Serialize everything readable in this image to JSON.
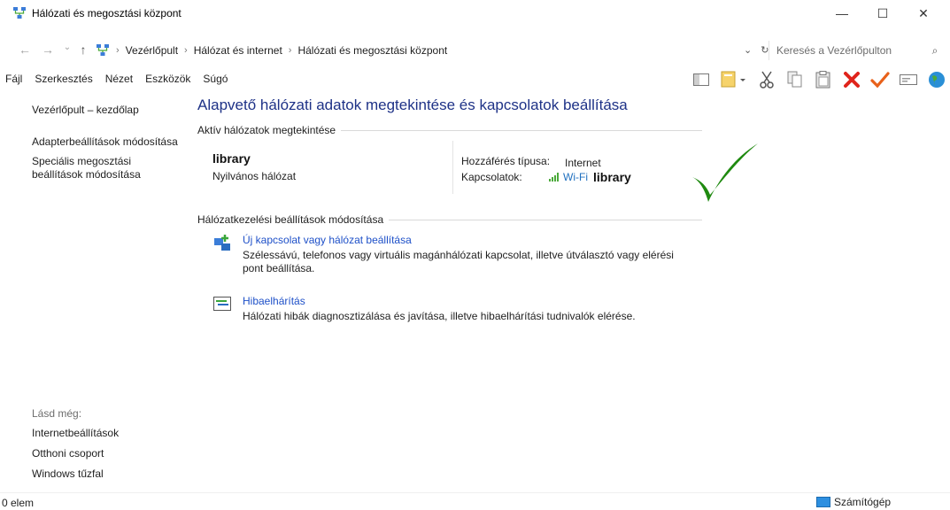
{
  "window": {
    "title": "Hálózati és megosztási központ",
    "controls": {
      "minimize": "—",
      "maximize": "☐",
      "close": "✕"
    }
  },
  "address": {
    "back": "←",
    "forward": "→",
    "history": "⌄",
    "up": "↑",
    "crumbs": [
      "Vezérlőpult",
      "Hálózat és internet",
      "Hálózati és megosztási központ"
    ],
    "separator": "›",
    "dropdown": "⌄",
    "refresh": "↻"
  },
  "search": {
    "placeholder": "Keresés a Vezérlőpulton",
    "icon": "⌕"
  },
  "menu": [
    "Fájl",
    "Szerkesztés",
    "Nézet",
    "Eszközök",
    "Súgó"
  ],
  "toolbar": {
    "icons": [
      "preview-pane-icon",
      "properties-icon",
      "cut-icon",
      "copy-icon",
      "paste-icon",
      "delete-icon",
      "check-icon",
      "rename-icon",
      "globe-icon"
    ],
    "colors": {
      "delete": "#e0241b",
      "check": "#e8611a",
      "globe": "#2a8fd6"
    }
  },
  "sidebar": {
    "links": [
      "Vezérlőpult – kezdőlap",
      "Adapterbeállítások módosítása",
      "Speciális megosztási\nbeállítások módosítása"
    ],
    "see_also_label": "Lásd még:",
    "see_also": [
      "Internetbeállítások",
      "Otthoni csoport",
      "Windows tűzfal"
    ]
  },
  "main": {
    "title": "Alapvető hálózati adatok megtekintése és kapcsolatok beállítása",
    "active_section": "Aktív hálózatok megtekintése",
    "network_name": "library",
    "network_type": "Nyilvános hálózat",
    "access_label": "Hozzáférés típusa:",
    "access_value": "Internet",
    "connections_label": "Kapcsolatok:",
    "connection_link": "Wi-Fi",
    "connection_name": "library",
    "change_section": "Hálózatkezelési beállítások módosítása",
    "tasks": [
      {
        "link": "Új kapcsolat vagy hálózat beállítása",
        "desc": "Szélessávú, telefonos vagy virtuális magánhálózati kapcsolat, illetve útválasztó vagy elérési pont beállítása."
      },
      {
        "link": "Hibaelhárítás",
        "desc": "Hálózati hibák diagnosztizálása és javítása, illetve hibaelhárítási tudnivalók elérése."
      }
    ],
    "accent_color": "#1e3287",
    "overlay_check_color": "#1f8a10"
  },
  "status": {
    "count": "0 elem",
    "location": "Számítógép"
  }
}
